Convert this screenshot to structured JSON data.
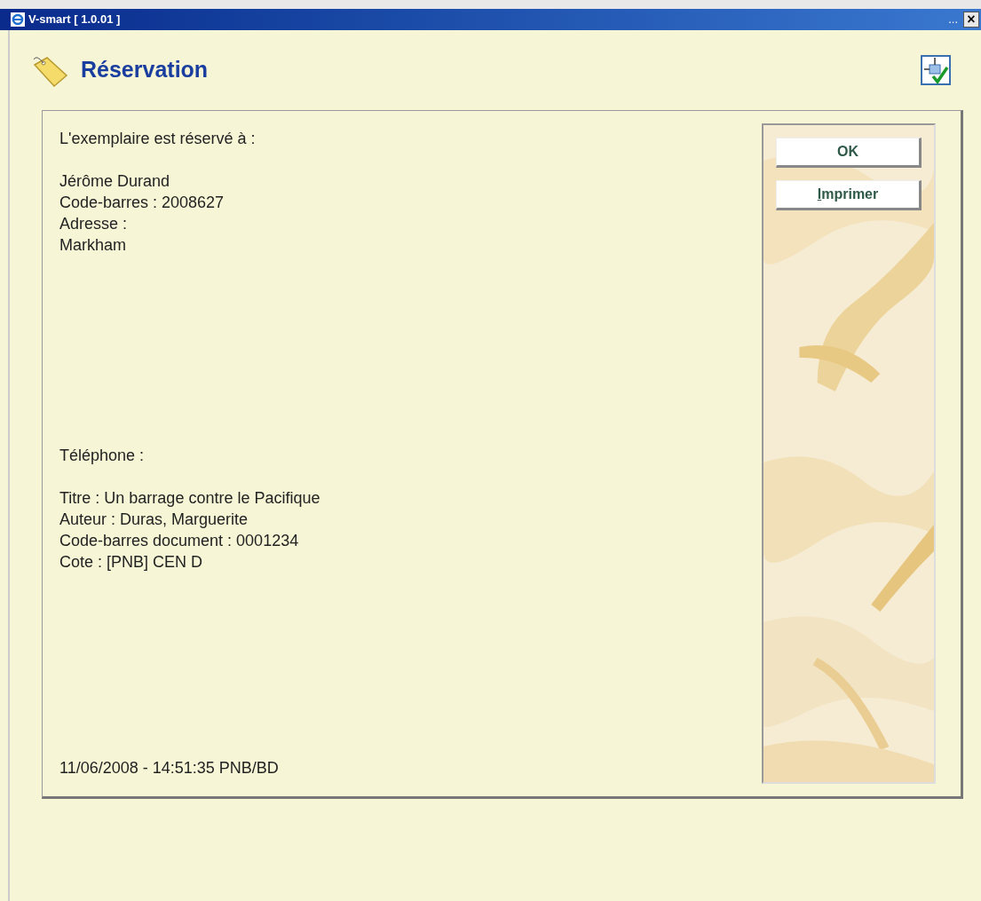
{
  "window": {
    "title": "V-smart [ 1.0.01 ]",
    "menu_dots": "...",
    "close": "×"
  },
  "page": {
    "title": "Réservation"
  },
  "message": {
    "intro": "L'exemplaire est réservé à :",
    "patron": [
      "Jérôme Durand",
      "Code-barres : 2008627",
      "Adresse :",
      "Markham"
    ],
    "phone": "Téléphone :",
    "item": [
      "Titre : Un barrage contre le Pacifique",
      "Auteur : Duras, Marguerite",
      "Code-barres document : 0001234",
      "Cote : [PNB] CEN D"
    ],
    "footer": "11/06/2008 - 14:51:35 PNB/BD"
  },
  "buttons": [
    {
      "label": "OK",
      "mnemonic_first": false
    },
    {
      "label": "Imprimer",
      "mnemonic_first": true
    }
  ]
}
